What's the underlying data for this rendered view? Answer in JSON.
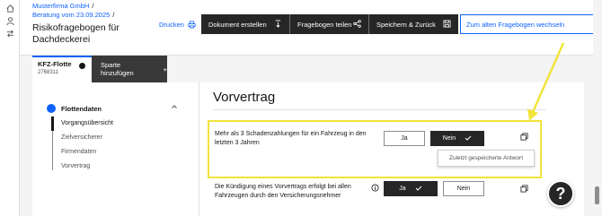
{
  "rail": {
    "icons": [
      "home-icon",
      "user-icon",
      "transfer-icon"
    ]
  },
  "header": {
    "breadcrumb": [
      {
        "label": "Musterfirma GmbH",
        "sep": "/"
      },
      {
        "label": "Beratung vom 23.09.2025",
        "sep": "/"
      }
    ],
    "title": "Risikofragebogen für Dachdeckerei",
    "print_label": "Drucken",
    "toolbar": {
      "create_doc": "Dokument erstellen",
      "share": "Fragebogen teilen",
      "save_back": "Speichern & Zurück",
      "switch_old": "Zum alten Fragebogen wechseln"
    }
  },
  "tabs": {
    "active": {
      "label": "KFZ-Flotte",
      "sub": "2768311"
    },
    "add_label": "Sparte hinzufügen"
  },
  "nav": {
    "section": "Flottendaten",
    "items": [
      {
        "label": "Vorgangsübersicht",
        "active": true
      },
      {
        "label": "Zielversicherer",
        "active": false
      },
      {
        "label": "Firmendaten",
        "active": false
      },
      {
        "label": "Vorvertrag",
        "active": false
      }
    ]
  },
  "main": {
    "heading": "Vorvertrag",
    "questions": [
      {
        "text": "Mehr als 3 Schadenzahlungen für ein Fahrzeug in den letzten 3 Jahren",
        "yes": "Ja",
        "no": "Nein",
        "selected": "no"
      },
      {
        "text": "Die Kündigung eines Vorvertrags erfolgt bei allen Fahrzeugen durch den Versicherungsnehmer",
        "yes": "Ja",
        "no": "Nein",
        "selected": "yes"
      }
    ],
    "tooltip": "Zuletzt gespeicherte Antwort"
  },
  "help_label": "?",
  "colors": {
    "accent": "#0f62fe",
    "dark": "#262626",
    "highlight": "#f1e43c"
  }
}
